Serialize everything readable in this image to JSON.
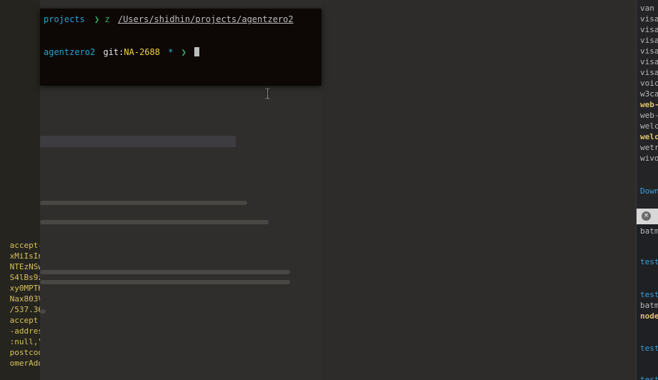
{
  "terminal": {
    "line1": {
      "dir": "projects",
      "arrow": "❯",
      "cmd": "z",
      "path": "/Users/shidhin/projects/agentzero2"
    },
    "line2": {
      "dir": "agentzero2",
      "git_label": "git:",
      "branch": "NA-2688",
      "dirty": "*",
      "arrow": "❯"
    }
  },
  "left_strip": {
    "lines": [
      "accept-",
      "xMiIsIn",
      "NTEzNSw",
      "S4lBs9z",
      "xy0MPTK",
      "Nax803V",
      "/537.36",
      "accept:",
      "-addres",
      ":null,\"",
      "postcod",
      "omerAdd"
    ]
  },
  "right_panel": {
    "items": [
      "van",
      "visa",
      "visa",
      "visa",
      "visa",
      "visa",
      "visa",
      "voic",
      "w3ca",
      "web-",
      "web-",
      "welc",
      "welc",
      "wetr",
      "wivo"
    ],
    "bold_items": [
      9,
      12
    ],
    "link": "Down",
    "close_icon": "×",
    "lower": [
      "batm",
      "test",
      "test",
      "batm",
      "node",
      "test",
      "test"
    ]
  },
  "colors": {
    "terminal_bg": "#0d0806",
    "dir": "#2aa1d3",
    "arrow": "#37b36a",
    "branch": "#f2d43a",
    "dirty": "#2bbcd6"
  }
}
